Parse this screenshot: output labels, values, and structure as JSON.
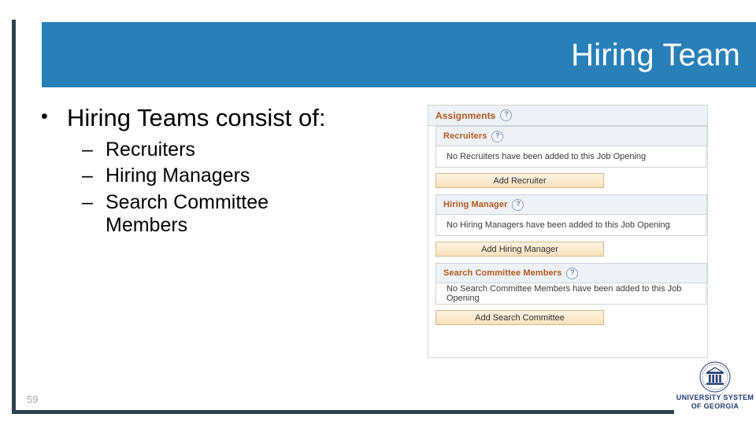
{
  "slide": {
    "title": "Hiring Team",
    "page_number": "59",
    "accent_color": "#2980b9",
    "rule_color": "#2f4050"
  },
  "content": {
    "bullet": {
      "marker": "•",
      "text": "Hiring Teams consist of:"
    },
    "sub_bullets": [
      {
        "marker": "–",
        "text": "Recruiters"
      },
      {
        "marker": "–",
        "text": "Hiring Managers"
      },
      {
        "marker": "–",
        "text": "Search Committee Members"
      }
    ]
  },
  "app_capture": {
    "help_icon_glyph": "?",
    "assignments": {
      "title": "Assignments"
    },
    "sections": [
      {
        "title": "Recruiters",
        "empty_message": "No Recruiters have been added to this Job Opening",
        "button_label": "Add Recruiter"
      },
      {
        "title": "Hiring Manager",
        "empty_message": "No Hiring Managers have been added to this Job Opening",
        "button_label": "Add Hiring Manager"
      },
      {
        "title": "Search Committee Members",
        "empty_message": "No Search Committee Members have been added to this Job Opening",
        "button_label": "Add Search Committee"
      }
    ]
  },
  "logo": {
    "line1": "UNIVERSITY SYSTEM",
    "line2": "OF GEORGIA"
  }
}
